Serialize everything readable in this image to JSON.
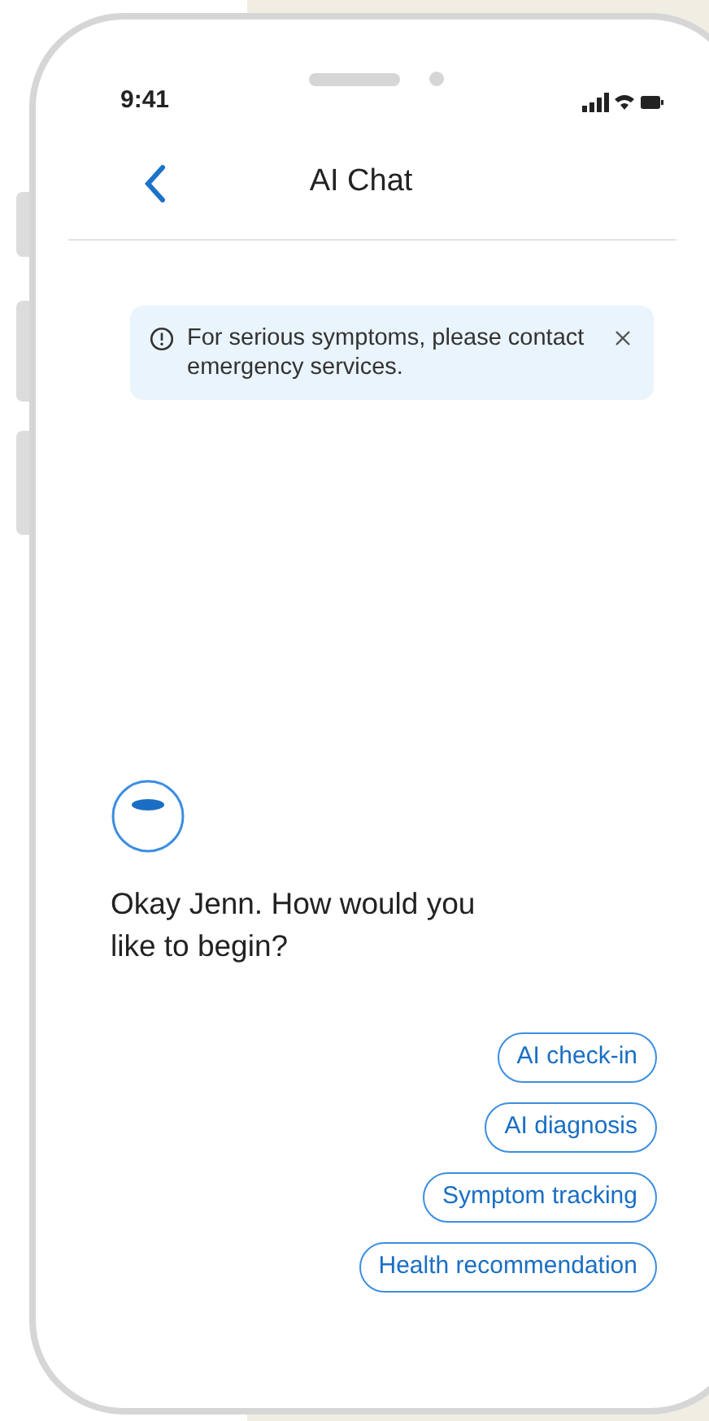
{
  "status_bar": {
    "time": "9:41"
  },
  "header": {
    "title": "AI Chat"
  },
  "alert": {
    "text": "For serious symptoms, please contact emergency services."
  },
  "message": {
    "text": "Okay Jenn. How would you like to begin?"
  },
  "options": [
    {
      "label": "AI check-in"
    },
    {
      "label": "AI diagnosis"
    },
    {
      "label": "Symptom tracking"
    },
    {
      "label": "Health recommendation"
    }
  ]
}
